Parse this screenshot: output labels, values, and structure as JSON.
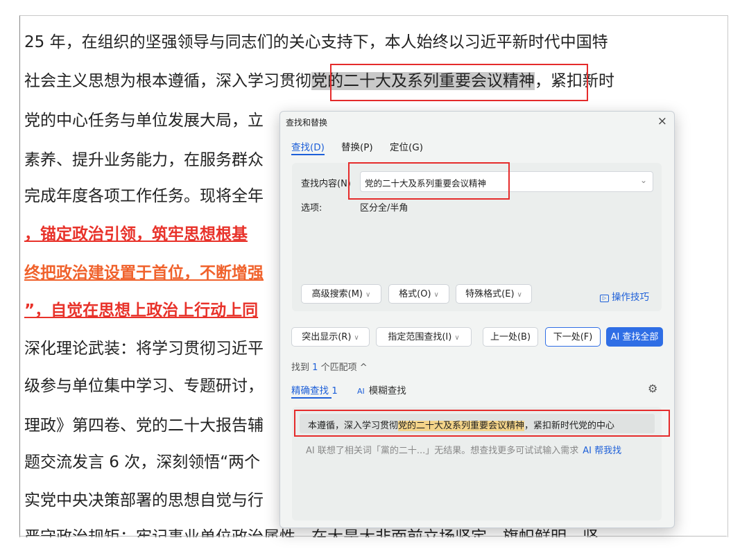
{
  "document": {
    "lines": [
      {
        "text": "25 年，在组织的坚强领导与同志们的关心支持下，本人始终以习近平新时代中国特",
        "style": "normal"
      },
      {
        "before": "社会主义思想为根本遵循，深入学习贯彻",
        "highlight": "党的二十大及系列重要会议精神",
        "after": "，紧扣新时",
        "style": "normal"
      },
      {
        "text": "党的中心任务与单位发展大局，立",
        "style": "normal"
      },
      {
        "text": "素养、提升业务能力，在服务群众",
        "style": "normal"
      },
      {
        "text": "完成年度各项工作任务。现将全年",
        "style": "normal"
      },
      {
        "text": "，锚定政治引领，筑牢思想根基",
        "style": "red"
      },
      {
        "text": "终把政治建设置于首位，不断增强",
        "style": "orange"
      },
      {
        "text": "”，自觉在思想上政治上行动上同",
        "style": "red"
      },
      {
        "text": "深化理论武装：将学习贯彻习近平",
        "style": "normal"
      },
      {
        "text": "级参与单位集中学习、专题研讨，",
        "style": "normal"
      },
      {
        "text": "理政》第四卷、党的二十大报告辅",
        "style": "normal"
      },
      {
        "text": "题交流发言 6 次，深刻领悟“两个",
        "style": "normal"
      },
      {
        "text": "实党中央决策部署的思想自觉与行",
        "style": "normal"
      },
      {
        "text": "严守政治规矩：牢记事业单位政治属性，在大是大非面前立场坚定、旗帜鲜明，坚",
        "style": "normal"
      }
    ]
  },
  "dialog": {
    "title": "查找和替换",
    "close": "×",
    "tabs": [
      "查找(D)",
      "替换(P)",
      "定位(G)"
    ],
    "find_label": "查找内容(N)",
    "find_value": "党的二十大及系列重要会议精神",
    "chevron": "⌄",
    "options_label": "选项:",
    "options_value": "区分全/半角",
    "buttons_row1": [
      "高级搜索(M)",
      "格式(O)",
      "特殊格式(E)"
    ],
    "tips": "操作技巧",
    "tips_icon": "▷",
    "buttons_row2": {
      "highlight": "突出显示(R)",
      "range_find": "指定范围查找(I)",
      "prev": "上一处(B)",
      "next": "下一处(F)",
      "ai_find_all": "AI 查找全部"
    },
    "found_prefix": "找到",
    "found_count": "1",
    "found_suffix": "个匹配项",
    "collapse": "^",
    "subtabs": {
      "exact": "精确查找 1",
      "ai_badge": "AI",
      "fuzzy": "模糊查找"
    },
    "gear": "⚙",
    "result": {
      "before": "本遵循，深入学习贯彻",
      "match": "党的二十大及系列重要会议精神",
      "after": "，紧扣新时代党的中心"
    },
    "ai_note": "AI 联想了相关词「黨的二十...」无结果。想查找更多可试试输入需求",
    "ai_help": "AI 帮我找"
  },
  "colors": {
    "accent": "#1d5fd8",
    "annotation_red": "#e52b2b",
    "heading_red": "#e8322a",
    "heading_orange": "#f0622c",
    "match_highlight": "#f4d489",
    "doc_highlight": "#c9c9c9"
  }
}
